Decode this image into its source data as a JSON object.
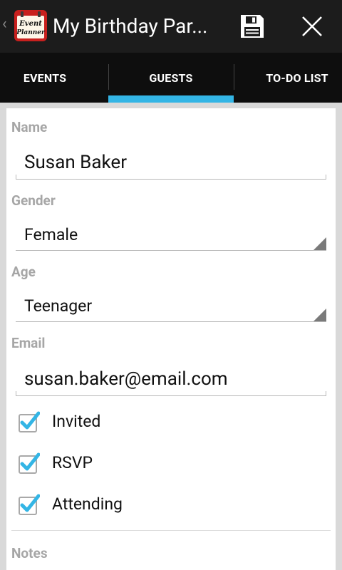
{
  "app": {
    "title": "My Birthday Par...",
    "logo_text_line1": "Event",
    "logo_text_line2": "Planner",
    "icons": {
      "up": "chevron-left-icon",
      "save": "floppy-disk-icon",
      "close": "close-icon"
    }
  },
  "tabs": [
    {
      "label": "EVENTS",
      "selected": false
    },
    {
      "label": "GUESTS",
      "selected": true
    },
    {
      "label": "TO-DO LIST",
      "selected": false
    }
  ],
  "form": {
    "name": {
      "label": "Name",
      "value": "Susan Baker"
    },
    "gender": {
      "label": "Gender",
      "value": "Female"
    },
    "age": {
      "label": "Age",
      "value": "Teenager"
    },
    "email": {
      "label": "Email",
      "value": "susan.baker@email.com"
    },
    "invited": {
      "label": "Invited",
      "checked": true
    },
    "rsvp": {
      "label": "RSVP",
      "checked": true
    },
    "attending": {
      "label": "Attending",
      "checked": true
    },
    "notes": {
      "label": "Notes"
    }
  },
  "colors": {
    "accent": "#33b5e5",
    "action_bar": "#1c1c1c",
    "tab_bar": "#0e0e0e",
    "label_gray": "#a6a6a6",
    "logo_red": "#c8201e"
  }
}
